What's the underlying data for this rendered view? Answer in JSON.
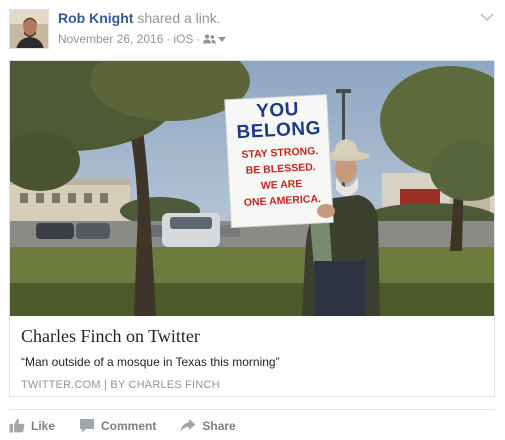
{
  "post": {
    "author": "Rob Knight",
    "action_text": "shared a link.",
    "date": "November 26, 2016",
    "separator": "·",
    "source": "iOS"
  },
  "photo": {
    "sign": {
      "line1": "YOU",
      "line2": "BELONG",
      "line3": "STAY STRONG.",
      "line4": "BE BLESSED.",
      "line5": "WE ARE",
      "line6": "ONE AMERICA."
    }
  },
  "link": {
    "title": "Charles Finch on Twitter",
    "description": "“Man outside of a mosque in Texas this morning”",
    "source_line": "TWITTER.COM | BY CHARLES FINCH"
  },
  "actions": {
    "like": "Like",
    "comment": "Comment",
    "share": "Share"
  },
  "icons": {
    "audience": "friends-icon",
    "menu": "chevron-down-icon",
    "like": "thumbs-up-icon",
    "comment": "comment-icon",
    "share": "share-arrow-icon"
  },
  "colors": {
    "author": "#365899",
    "meta": "#90949c",
    "action": "#7f7f7f",
    "sign_blue": "#1b3a8a",
    "sign_red": "#c0261f"
  }
}
